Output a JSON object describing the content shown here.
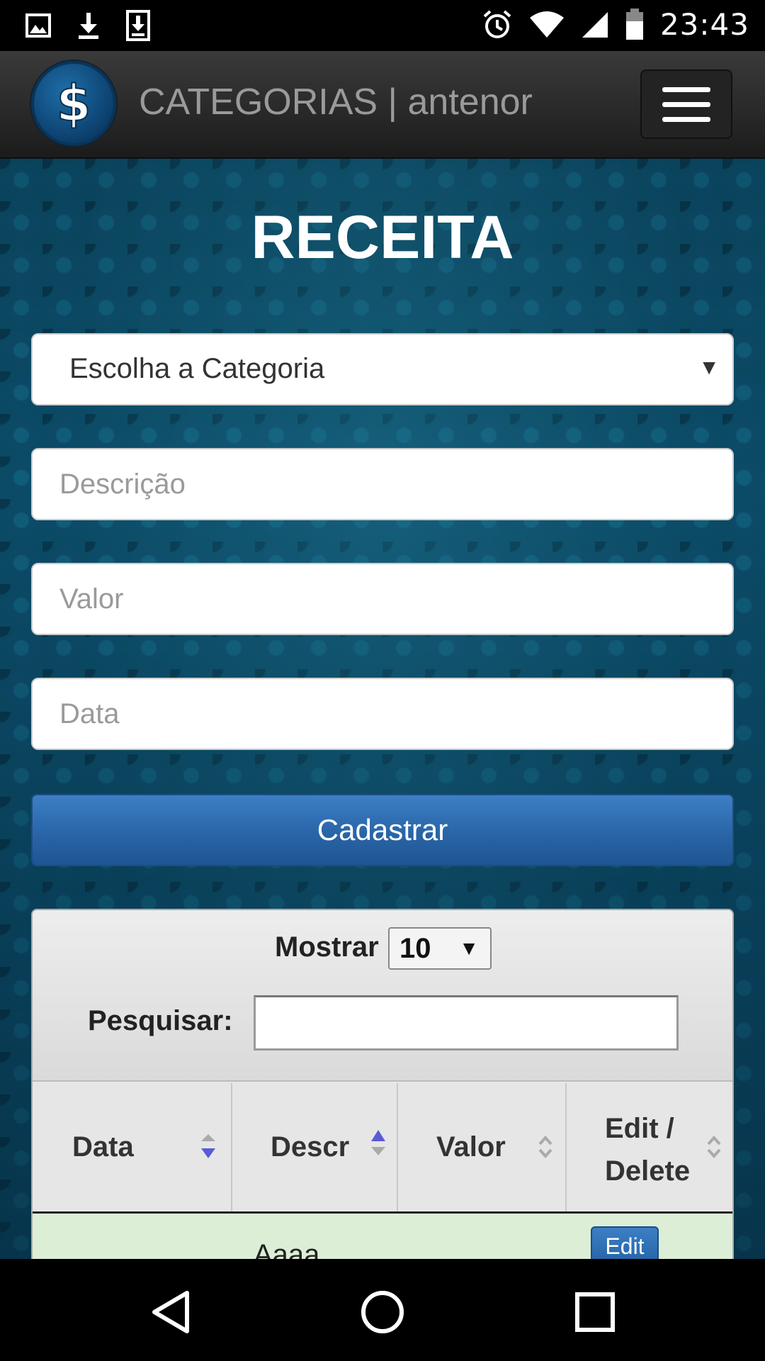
{
  "status_bar": {
    "time": "23:43",
    "left_icons": [
      "image-icon",
      "download-icon",
      "download-box-icon"
    ],
    "right_icons": [
      "alarm-icon",
      "wifi-icon",
      "signal-icon",
      "battery-icon"
    ]
  },
  "header": {
    "logo_icon": "dollar-logo-icon",
    "logo_glyph": "$",
    "title": "CATEGORIAS | antenor",
    "menu_icon": "hamburger-menu-icon"
  },
  "form": {
    "title": "RECEITA",
    "category_select": "Escolha a Categoria",
    "description_placeholder": "Descrição",
    "value_placeholder": "Valor",
    "date_placeholder": "Data",
    "submit_label": "Cadastrar"
  },
  "table": {
    "show_label": "Mostrar",
    "show_value": "10",
    "search_label": "Pesquisar:",
    "search_value": "",
    "columns": [
      {
        "label": "Data",
        "sort": "descending"
      },
      {
        "label": "Descr",
        "sort": "ascending"
      },
      {
        "label": "Valor",
        "sort": "none"
      },
      {
        "label": "Edit / Delete",
        "sort": "none"
      }
    ],
    "rows": [
      {
        "descr": "Aaaa",
        "edit_label": "Edit"
      }
    ]
  },
  "nav_bar": {
    "icons": [
      "back-icon",
      "home-icon",
      "recents-icon"
    ]
  },
  "colors": {
    "header_bg": "#2b2b2b",
    "primary_button": "#2f6fb3",
    "row_highlight": "#ddeed6",
    "sort_active": "#5a5ad8"
  }
}
